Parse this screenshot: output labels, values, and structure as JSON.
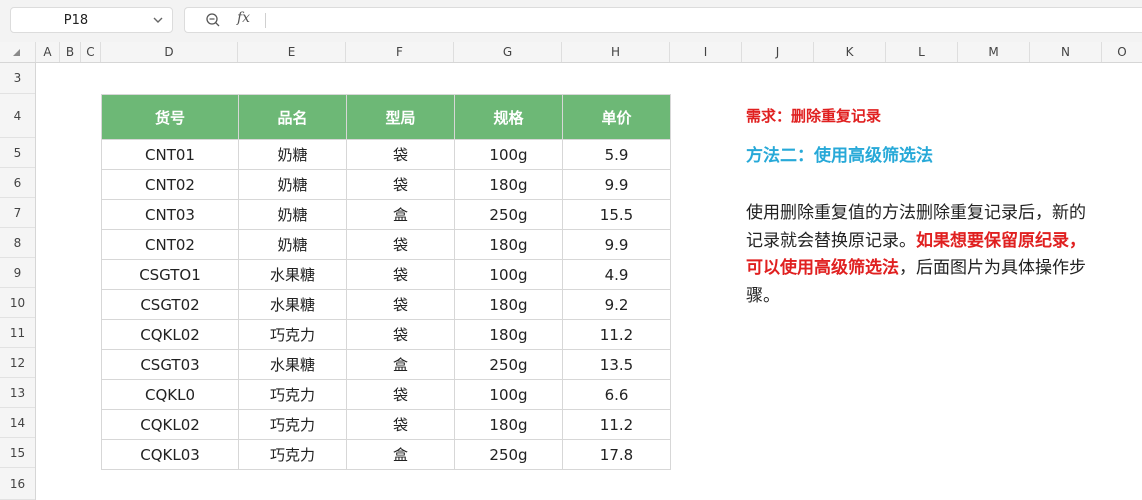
{
  "formula_bar": {
    "cell_ref": "P18",
    "fx_label": "fx",
    "formula": ""
  },
  "columns": [
    "A",
    "B",
    "C",
    "D",
    "E",
    "F",
    "G",
    "H",
    "I",
    "J",
    "K",
    "L",
    "M",
    "N",
    "O"
  ],
  "rows": [
    "3",
    "4",
    "5",
    "6",
    "7",
    "8",
    "9",
    "10",
    "11",
    "12",
    "13",
    "14",
    "15",
    "16"
  ],
  "table": {
    "headers": [
      "货号",
      "品名",
      "型局",
      "规格",
      "单价"
    ],
    "rows": [
      [
        "CNT01",
        "奶糖",
        "袋",
        "100g",
        "5.9"
      ],
      [
        "CNT02",
        "奶糖",
        "袋",
        "180g",
        "9.9"
      ],
      [
        "CNT03",
        "奶糖",
        "盒",
        "250g",
        "15.5"
      ],
      [
        "CNT02",
        "奶糖",
        "袋",
        "180g",
        "9.9"
      ],
      [
        "CSGTO1",
        "水果糖",
        "袋",
        "100g",
        "4.9"
      ],
      [
        "CSGT02",
        "水果糖",
        "袋",
        "180g",
        "9.2"
      ],
      [
        "CQKL02",
        "巧克力",
        "袋",
        "180g",
        "11.2"
      ],
      [
        "CSGT03",
        "水果糖",
        "盒",
        "250g",
        "13.5"
      ],
      [
        "CQKL0",
        "巧克力",
        "袋",
        "100g",
        "6.6"
      ],
      [
        "CQKL02",
        "巧克力",
        "袋",
        "180g",
        "11.2"
      ],
      [
        "CQKL03",
        "巧克力",
        "盒",
        "250g",
        "17.8"
      ]
    ]
  },
  "notes": {
    "requirement": "需求：删除重复记录",
    "method": "方法二：使用高级筛选法",
    "desc_normal_1": "使用删除重复值的方法删除重复记录后，新的记录就会替换原记录。",
    "desc_highlight": "如果想要保留原纪录，可以使用高级筛选法",
    "desc_normal_2": "，后面图片为具体操作步骤。"
  },
  "colors": {
    "header_bg": "#6db876",
    "highlight_red": "#e02020",
    "method_blue": "#27a9d8"
  }
}
